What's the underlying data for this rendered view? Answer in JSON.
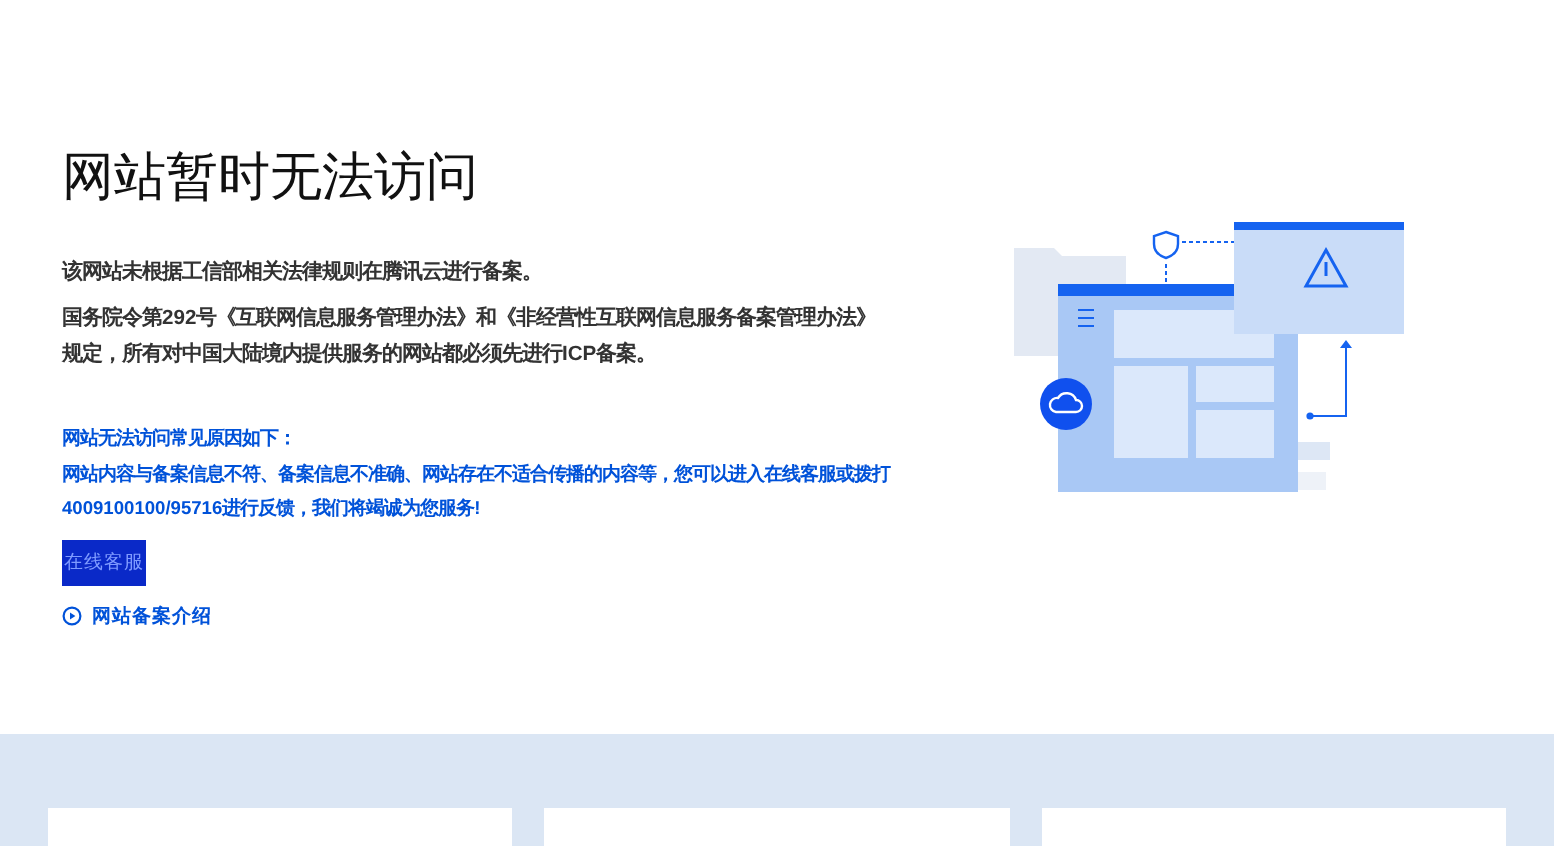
{
  "title": "网站暂时无法访问",
  "notice": "该网站未根据工信部相关法律规则在腾讯云进行备案。",
  "regulation": [
    "国务院令第292号《互联网信息服务管理办法》和《非经营性互联网信息服务备案管理办法》",
    "规定，所有对中国大陆境内提供服务的网站都必须先进行ICP备案。"
  ],
  "reasons_heading": "网站无法访问常见原因如下：",
  "reasons": [
    "网站内容与备案信息不符、备案信息不准确、网站存在不适合传播的内容等，您可以进入在线客服或拨打",
    "4009100100/95716进行反馈，我们将竭诚为您服务!"
  ],
  "button": "在线客服",
  "link": "网站备案介绍"
}
